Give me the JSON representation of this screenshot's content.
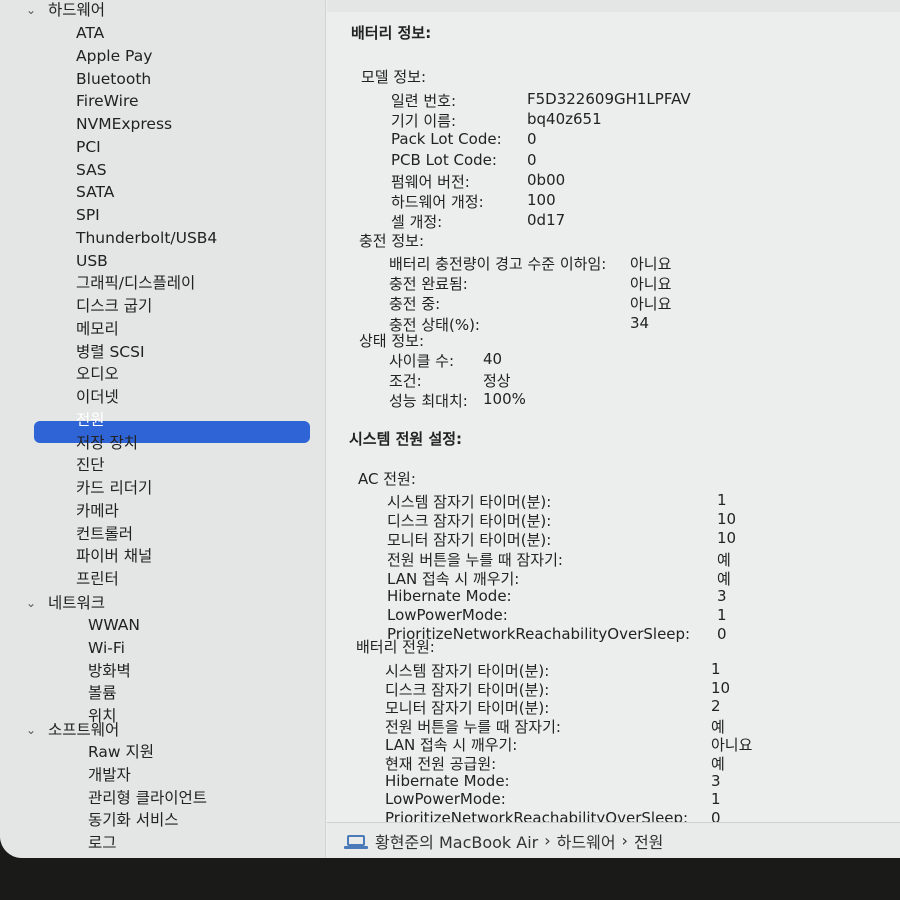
{
  "sidebar": {
    "hardware_group": "하드웨어",
    "hardware_items": [
      "ATA",
      "Apple Pay",
      "Bluetooth",
      "FireWire",
      "NVMExpress",
      "PCI",
      "SAS",
      "SATA",
      "SPI",
      "Thunderbolt/USB4",
      "USB",
      "그래픽/디스플레이",
      "디스크 굽기",
      "메모리",
      "병렬 SCSI",
      "오디오",
      "이더넷",
      "전원",
      "저장 장치",
      "진단",
      "카드 리더기",
      "카메라",
      "컨트롤러",
      "파이버 채널",
      "프린터"
    ],
    "selected": "전원",
    "network_group": "네트워크",
    "network_items": [
      "WWAN",
      "Wi-Fi",
      "방화벽",
      "볼륨",
      "위치"
    ],
    "software_group": "소프트웨어",
    "software_items": [
      "Raw 지원",
      "개발자",
      "관리형 클라이언트",
      "동기화 서비스",
      "로그"
    ]
  },
  "battery": {
    "title": "배터리 정보:",
    "model_heading": "모델 정보:",
    "model": [
      [
        "일련 번호:",
        "F5D322609GH1LPFAV"
      ],
      [
        "기기 이름:",
        "bq40z651"
      ],
      [
        "Pack Lot Code:",
        "0"
      ],
      [
        "PCB Lot Code:",
        "0"
      ],
      [
        "펌웨어 버전:",
        "0b00"
      ],
      [
        "하드웨어 개정:",
        "100"
      ],
      [
        "셀 개정:",
        "0d17"
      ]
    ],
    "charge_heading": "충전 정보:",
    "charge": [
      [
        "배터리 충전량이 경고 수준 이하임:",
        "아니요"
      ],
      [
        "충전 완료됨:",
        "아니요"
      ],
      [
        "충전 중:",
        "아니요"
      ],
      [
        "충전 상태(%):",
        "34"
      ]
    ],
    "health_heading": "상태 정보:",
    "health": [
      [
        "사이클 수:",
        "40"
      ],
      [
        "조건:",
        "정상"
      ],
      [
        "성능 최대치:",
        "100%"
      ]
    ]
  },
  "power": {
    "title": "시스템 전원 설정:",
    "ac_heading": "AC 전원:",
    "ac": [
      [
        "시스템 잠자기 타이머(분):",
        "1"
      ],
      [
        "디스크 잠자기 타이머(분):",
        "10"
      ],
      [
        "모니터 잠자기 타이머(분):",
        "10"
      ],
      [
        "전원 버튼을 누를 때 잠자기:",
        "예"
      ],
      [
        "LAN 접속 시 깨우기:",
        "예"
      ],
      [
        "Hibernate Mode:",
        "3"
      ],
      [
        "LowPowerMode:",
        "1"
      ],
      [
        "PrioritizeNetworkReachabilityOverSleep:",
        "0"
      ]
    ],
    "battery_heading": "배터리 전원:",
    "battery": [
      [
        "시스템 잠자기 타이머(분):",
        "1"
      ],
      [
        "디스크 잠자기 타이머(분):",
        "10"
      ],
      [
        "모니터 잠자기 타이머(분):",
        "2"
      ],
      [
        "전원 버튼을 누를 때 잠자기:",
        "예"
      ],
      [
        "LAN 접속 시 깨우기:",
        "아니요"
      ],
      [
        "현재 전원 공급원:",
        "예"
      ],
      [
        "Hibernate Mode:",
        "3"
      ],
      [
        "LowPowerMode:",
        "1"
      ],
      [
        "PrioritizeNetworkReachabilityOverSleep:",
        "0"
      ]
    ]
  },
  "pathbar": {
    "computer": "황현준의 MacBook Air",
    "sep": "›",
    "section": "하드웨어",
    "item": "전원"
  }
}
